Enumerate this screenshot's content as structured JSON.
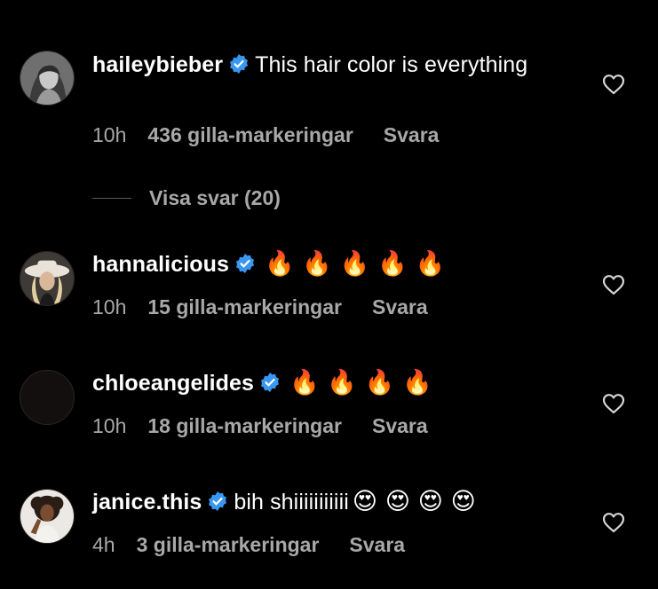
{
  "colors": {
    "background": "#000000",
    "text_primary": "#ffffff",
    "text_secondary": "#a8a8a8",
    "verified_blue": "#3897f0"
  },
  "comments": [
    {
      "username": "haileybieber",
      "verified": true,
      "text": "This hair color is everything",
      "emojis": "",
      "time": "10h",
      "likes": "436 gilla-markeringar",
      "reply": "Svara",
      "avatar_icon": "avatar-photo"
    },
    {
      "username": "hannalicious",
      "verified": true,
      "text": "",
      "emojis": "🔥🔥🔥🔥🔥",
      "time": "10h",
      "likes": "15 gilla-markeringar",
      "reply": "Svara",
      "avatar_icon": "avatar-photo"
    },
    {
      "username": "chloeangelides",
      "verified": true,
      "text": "",
      "emojis": "🔥🔥🔥🔥",
      "time": "10h",
      "likes": "18 gilla-markeringar",
      "reply": "Svara",
      "avatar_icon": "avatar-dark"
    },
    {
      "username": "janice.this",
      "verified": true,
      "text": "bih shiiiiiiiiiii",
      "emojis": "😍😍😍😍",
      "time": "4h",
      "likes": "3 gilla-markeringar",
      "reply": "Svara",
      "avatar_icon": "avatar-photo"
    }
  ],
  "view_replies": {
    "label": "Visa svar (20)"
  },
  "icons": {
    "like": "heart-outline-icon",
    "verified": "verified-badge-icon"
  }
}
